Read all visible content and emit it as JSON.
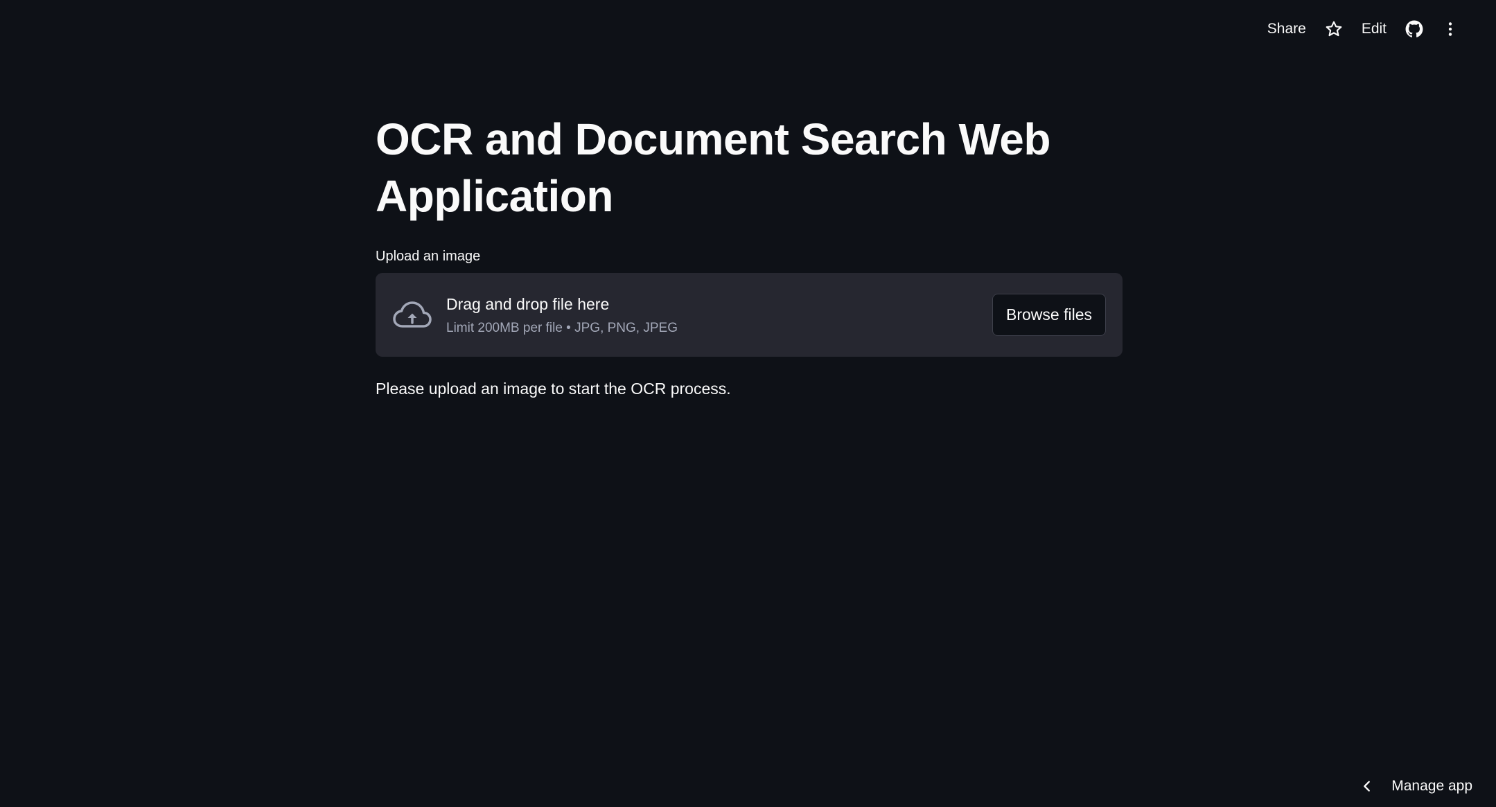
{
  "toolbar": {
    "share_label": "Share",
    "star_icon": "star-icon",
    "edit_label": "Edit",
    "github_icon": "github-icon",
    "menu_icon": "kebab-menu-icon"
  },
  "main": {
    "title": "OCR and Document Search Web Application",
    "uploader": {
      "label": "Upload an image",
      "icon": "cloud-upload-icon",
      "primary_text": "Drag and drop file here",
      "secondary_text": "Limit 200MB per file • JPG, PNG, JPEG",
      "browse_label": "Browse files"
    },
    "status_text": "Please upload an image to start the OCR process."
  },
  "footer": {
    "manage_app_label": "Manage app",
    "chevron_icon": "chevron-left-icon"
  },
  "colors": {
    "background": "#0e1117",
    "surface": "#262730",
    "text": "#fafafa",
    "muted_text": "#a3a8b8"
  }
}
